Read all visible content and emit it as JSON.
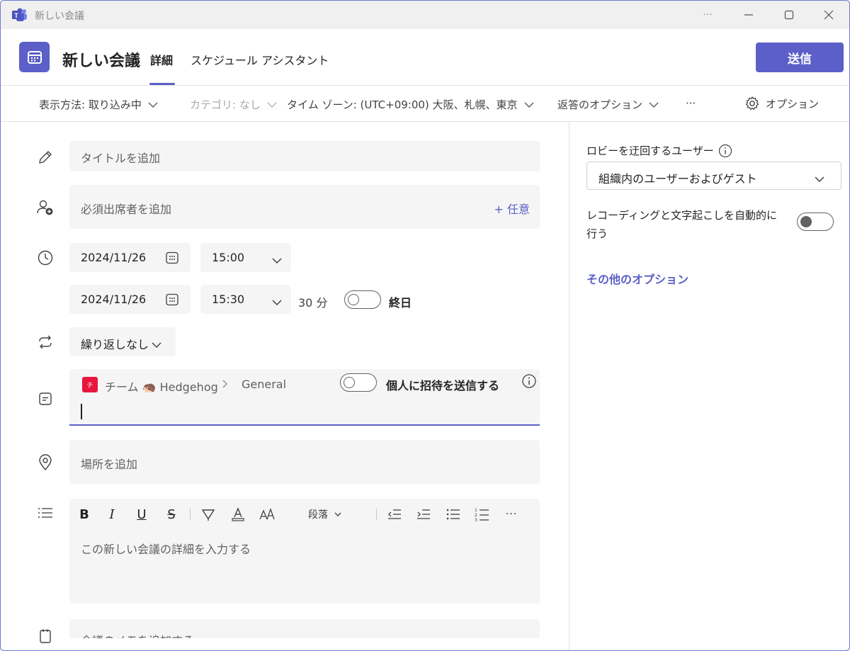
{
  "window": {
    "title": "新しい会議",
    "more": "···"
  },
  "header": {
    "title": "新しい会議",
    "tabs": [
      {
        "label": "詳細",
        "active": true
      },
      {
        "label": "スケジュール アシスタント",
        "active": false
      }
    ],
    "send_label": "送信",
    "accent": "#5b5fc7"
  },
  "toolbar": {
    "show_as": "表示方法: 取り込み中",
    "category": "カテゴリ: なし",
    "timezone": "タイム ゾーン: (UTC+09:00) 大阪、札幌、東京",
    "response_options": "返答のオプション",
    "more": "···",
    "options": "オプション"
  },
  "form": {
    "title_placeholder": "タイトルを追加",
    "attendees_placeholder": "必須出席者を追加",
    "optional_label": "+ 任意",
    "start_date": "2024/11/26",
    "start_time": "15:00",
    "end_date": "2024/11/26",
    "end_time": "15:30",
    "duration": "30 分",
    "all_day": "終日",
    "repeat": "繰り返しなし",
    "channel": {
      "team": "チーム",
      "team_name": "Hedgehog",
      "channel_name": "General",
      "private_invite": "個人に招待を送信する"
    },
    "location_placeholder": "場所を追加",
    "editor": {
      "paragraph": "段落",
      "placeholder": "この新しい会議の詳細を入力する"
    },
    "notes_placeholder": "会議のメモを追加する"
  },
  "right_panel": {
    "lobby_label": "ロビーを迂回するユーザー",
    "lobby_value": "組織内のユーザーおよびゲスト",
    "recording_label_1": "レコーディングと文字起こしを自動的に",
    "recording_label_2": "行う",
    "more_options": "その他のオプション"
  }
}
